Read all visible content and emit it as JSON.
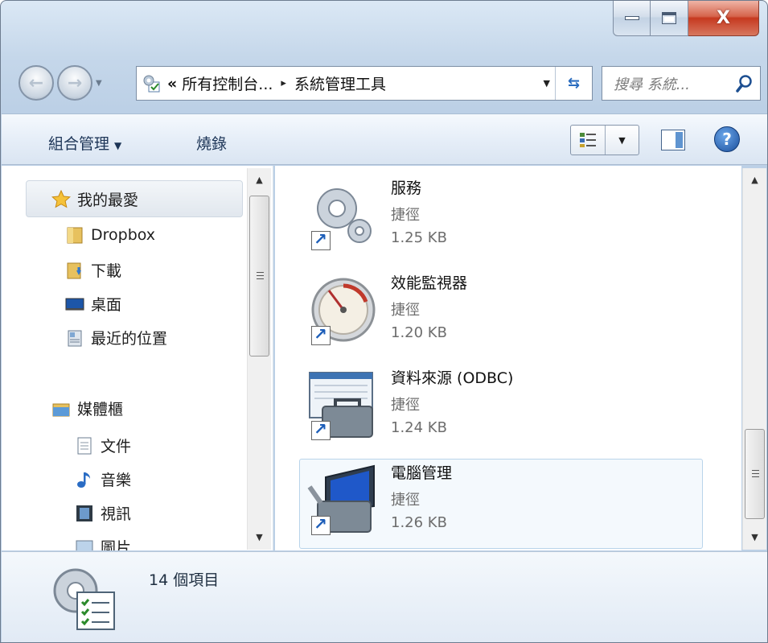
{
  "window": {
    "caption_buttons": [
      "minimize",
      "maximize",
      "close"
    ],
    "close_symbol": "X"
  },
  "navigation": {
    "back_icon": "back-arrow-icon",
    "forward_icon": "forward-arrow-icon",
    "address": {
      "overflow": "«",
      "parts": [
        "所有控制台...",
        "系統管理工具"
      ],
      "separator": "▸"
    },
    "search_placeholder": "搜尋 系統..."
  },
  "toolbar": {
    "organize": "組合管理",
    "burn": "燒錄",
    "help": "?"
  },
  "nav_pane": {
    "favorites": "我的最愛",
    "items": [
      "Dropbox",
      "下載",
      "桌面",
      "最近的位置"
    ],
    "libraries": "媒體櫃",
    "library_items": [
      "文件",
      "音樂",
      "視訊",
      "圖片"
    ]
  },
  "files": [
    {
      "name": "服務",
      "type": "捷徑",
      "size": "1.25 KB",
      "icon": "gears-icon"
    },
    {
      "name": "效能監視器",
      "type": "捷徑",
      "size": "1.20 KB",
      "icon": "gauge-icon"
    },
    {
      "name": "資料來源 (ODBC)",
      "type": "捷徑",
      "size": "1.24 KB",
      "icon": "toolbox-icon"
    },
    {
      "name": "電腦管理",
      "type": "捷徑",
      "size": "1.26 KB",
      "icon": "computer-toolbox-icon",
      "selected": true
    }
  ],
  "details": {
    "count_text": "14 個項目"
  },
  "colors": {
    "accent": "#2a6cbf",
    "selection_border": "#b9d4ea"
  }
}
